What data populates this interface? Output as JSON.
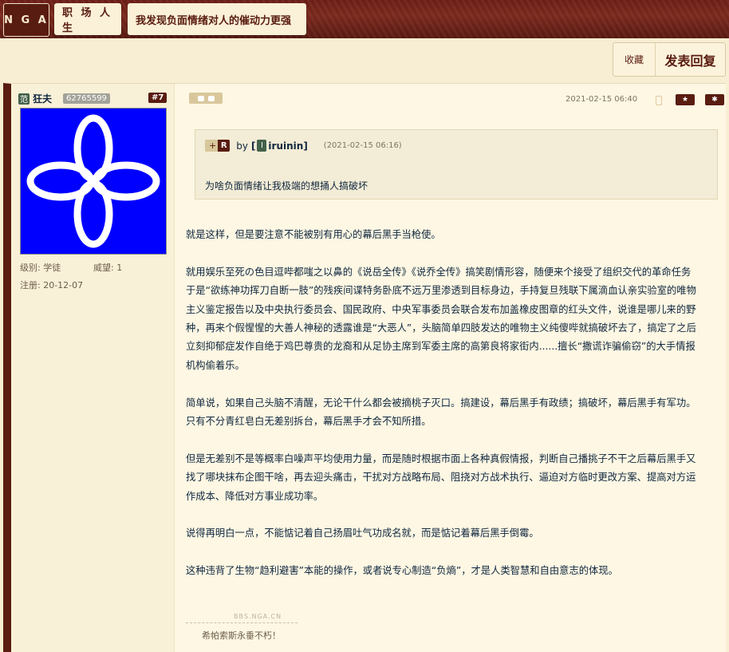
{
  "header": {
    "logo": "N G A",
    "breadcrumb_forum": "职 场 人 生",
    "breadcrumb_thread": "我发现负面情绪对人的催动力更强"
  },
  "actions": {
    "favorite": "收藏",
    "reply": "发表回复"
  },
  "post": {
    "user": {
      "initial": "范",
      "name": "狂夫",
      "uid": "62765599",
      "level_label": "级别:",
      "level": "学徒",
      "prestige_label": "威望:",
      "prestige": "1",
      "registered_label": "注册:",
      "registered": "20-12-07"
    },
    "floor": "#7",
    "date": "2021-02-15 06:40",
    "quote": {
      "plus": "+",
      "r_badge": "R",
      "by": "by",
      "open_bracket": "[",
      "user_initial": "I",
      "user_name": "iruinin",
      "close_bracket": "]",
      "date": "(2021-02-15 06:16)",
      "text": "为啥负面情绪让我极端的想捅人搞破坏"
    },
    "paragraphs": [
      "就是这样，但是要注意不能被别有用心的幕后黑手当枪使。",
      "就用娱乐至死の色目逗哔都嗤之以鼻的《说岳全传》《说乔全传》搞笑剧情形容，随便来个接受了组织交代的革命任务\n于是“欲练神功挥刀自断一肢”的残疾间谍特务卧底不远万里渗透到目标身边，手持复旦残联下属滴血认亲实验室的唯物\n主义鉴定报告以及中央执行委员会、国民政府、中央军事委员会联合发布加盖橡皮图章的红头文件，说谁是哪儿来的野\n种，再来个假惺惺的大善人神秘的透露谁是“大恶人”，头脑简单四肢发达的唯物主义纯傻哔就搞破坏去了，搞定了之后\n立刻抑郁症发作自绝于鸡巴尊贵的龙裔和从足协主席到军委主席的高第良将家街内......擅长“撒谎诈骗偷窃”的大手情报\n机构偷着乐。",
      "简单说，如果自己头脑不清醒，无论干什么都会被摘桃子灭口。搞建设，幕后黑手有政绩；搞破坏，幕后黑手有军功。\n只有不分青红皂白无差别拆台，幕后黑手才会不知所措。",
      "但是无差别不是等概率白噪声平均使用力量，而是随时根据市面上各种真假情报，判断自己播挑子不干之后幕后黑手又\n找了哪块抹布企图干啥，再去迎头痛击，干扰对方战略布局、阻挠对方战术执行、逼迫对方临时更改方案、提高对方运\n作成本、降低对方事业成功率。",
      "说得再明白一点，不能惦记着自己扬眉吐气功成名就，而是惦记着幕后黑手倒霉。",
      "这种违背了生物“趋利避害”本能的操作，或者说专心制造“负熵”，才是人类智慧和自由意志的体现。"
    ],
    "watermark": "BBS.NGA.CN",
    "signature": "希帕索斯永垂不朽！"
  }
}
